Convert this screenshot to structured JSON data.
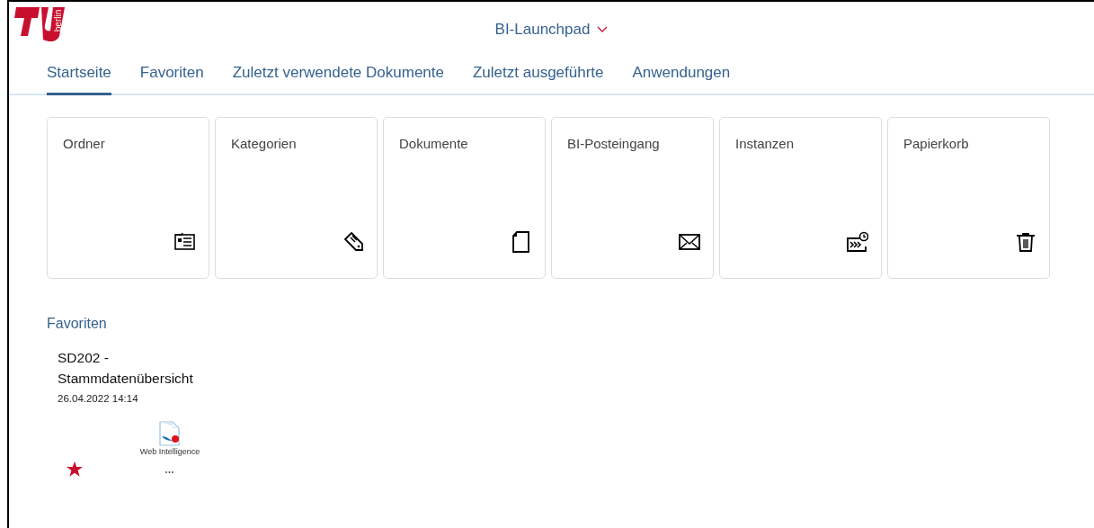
{
  "header": {
    "logo_text": "berlin",
    "title": "BI-Launchpad"
  },
  "tabs": [
    {
      "label": "Startseite",
      "selected": true
    },
    {
      "label": "Favoriten",
      "selected": false
    },
    {
      "label": "Zuletzt verwendete Dokumente",
      "selected": false
    },
    {
      "label": "Zuletzt ausgeführte",
      "selected": false
    },
    {
      "label": "Anwendungen",
      "selected": false
    }
  ],
  "tiles": [
    {
      "label": "Ordner",
      "kind": "folder"
    },
    {
      "label": "Kategorien",
      "kind": "tag"
    },
    {
      "label": "Dokumente",
      "kind": "document"
    },
    {
      "label": "BI-Posteingang",
      "kind": "envelope"
    },
    {
      "label": "Instanzen",
      "kind": "schedule"
    },
    {
      "label": "Papierkorb",
      "kind": "trash"
    }
  ],
  "favorites": {
    "heading": "Favoriten",
    "items": [
      {
        "title": "SD202 - Stammdatenübersicht",
        "date": "26.04.2022 14:14",
        "type": "Web Intelligence",
        "more": "•••",
        "favorite": true
      }
    ]
  }
}
